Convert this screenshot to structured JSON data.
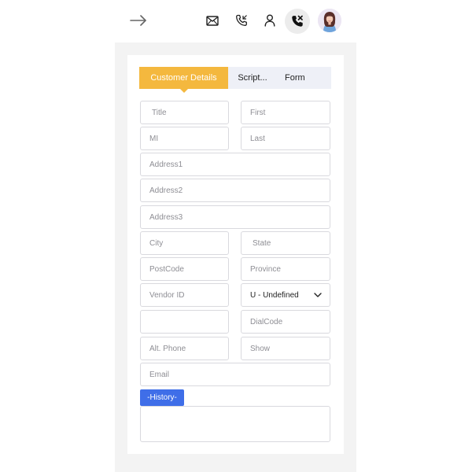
{
  "toolbar": {
    "icons": [
      "arrow-right-icon",
      "mail-icon",
      "phone-incoming-icon",
      "user-icon",
      "call-end-icon",
      "avatar"
    ]
  },
  "tabs": [
    {
      "label": "Customer Details",
      "active": true
    },
    {
      "label": "Script..."
    },
    {
      "label": "Form"
    }
  ],
  "colors": {
    "active_tab": "#f4b83e",
    "history_button": "#3f6ee8",
    "panel_bg": "#f3f3f3"
  },
  "form": {
    "title": "Title",
    "first": "First",
    "mi": "MI",
    "last": "Last",
    "address1": "Address1",
    "address2": "Address2",
    "address3": "Address3",
    "city": "City",
    "state": "State",
    "postcode": "PostCode",
    "province": "Province",
    "vendor_id": "Vendor ID",
    "gender_value": "U - Undefined",
    "dialcode": "DialCode",
    "alt_phone": "Alt. Phone",
    "show": "Show",
    "email": "Email"
  },
  "history": {
    "button_label": "-History-"
  }
}
